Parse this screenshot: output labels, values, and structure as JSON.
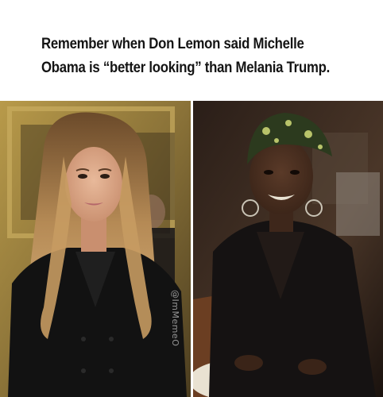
{
  "caption": {
    "line1": "Remember when Don Lemon said Michelle",
    "line2": "Obama is “better looking” than Melania Trump."
  },
  "watermark": "@ImMemeO",
  "photos": {
    "left": {
      "subject": "woman with long blonde highlighted hair in black double-breasted coat"
    },
    "right": {
      "subject": "smiling woman in patterned head wrap and black top"
    }
  }
}
